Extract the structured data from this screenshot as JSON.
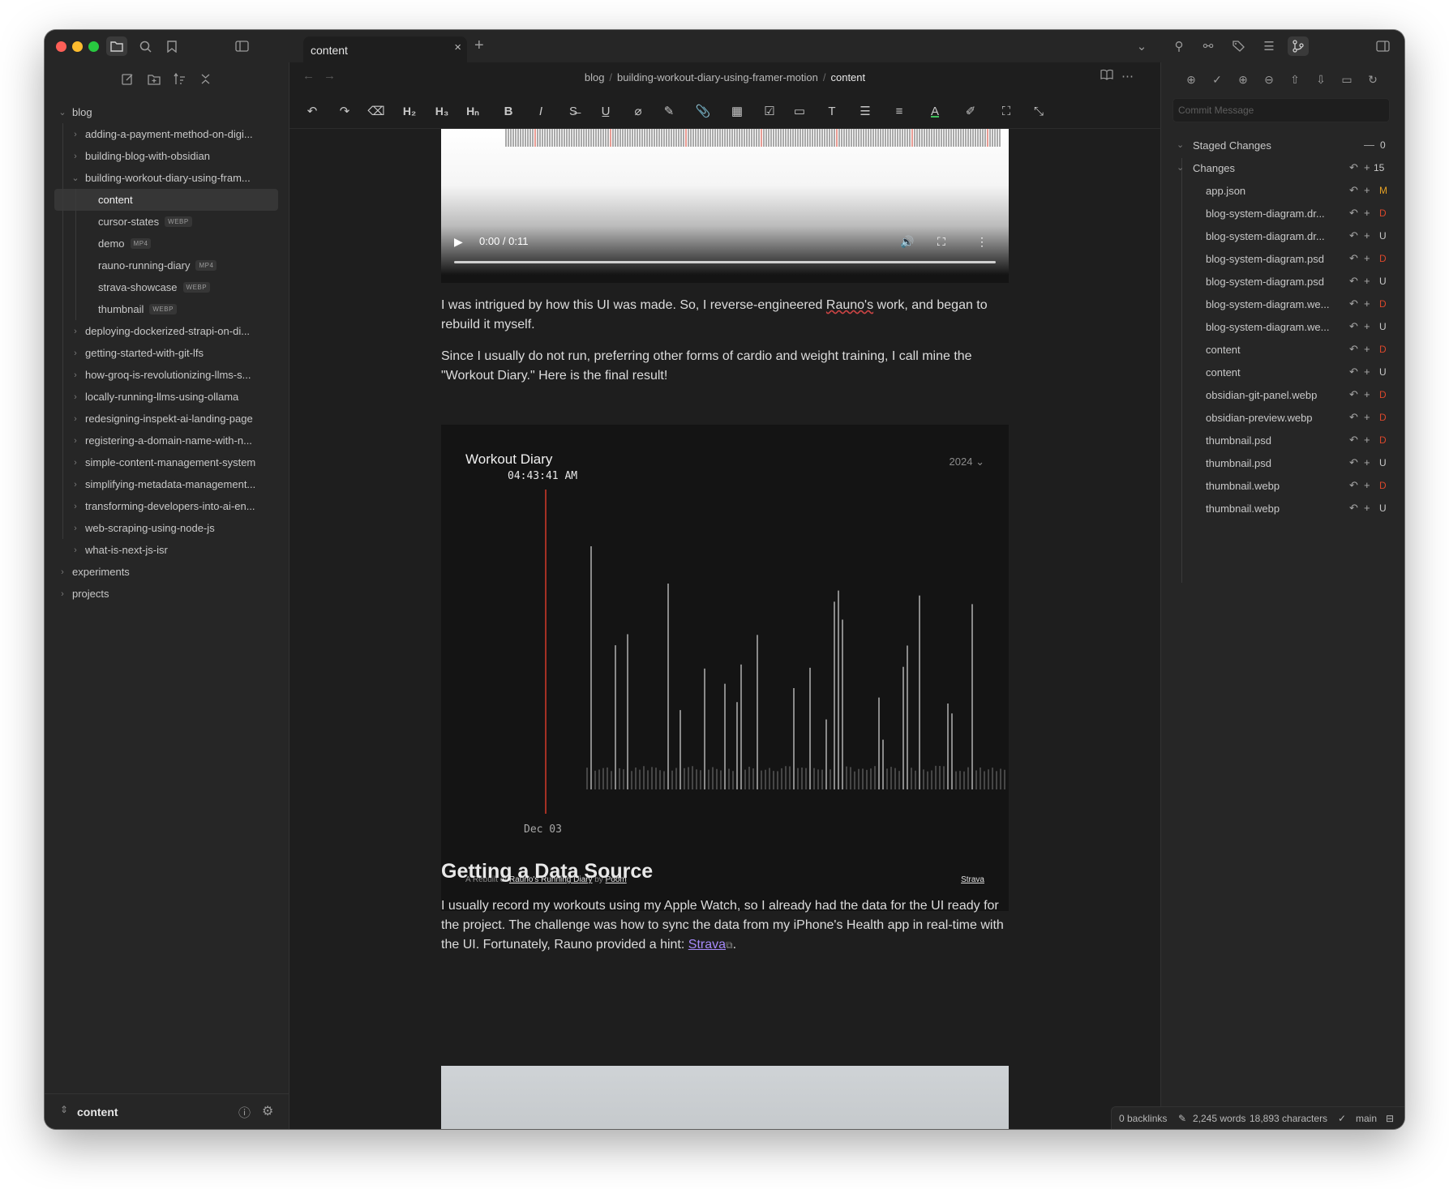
{
  "colors": {
    "window_bg": "#1e1e1e",
    "sidebar_bg": "#262626",
    "accent": "#a68af9",
    "deleted": "#d9472b",
    "modified": "#e5a125",
    "diary_line": "#ffffff",
    "diary_current": "#d43a2a"
  },
  "titlebar": {
    "tab_label": "content",
    "icons": [
      "folder-icon",
      "search-icon",
      "bookmark-icon",
      "sidebar-toggle-icon"
    ]
  },
  "left_sidebar": {
    "actions": [
      "new-note-icon",
      "new-folder-icon",
      "sort-icon",
      "collapse-icon"
    ],
    "tree": [
      {
        "label": "blog",
        "depth": 0,
        "open": true
      },
      {
        "label": "adding-a-payment-method-on-digi...",
        "depth": 1,
        "open": false
      },
      {
        "label": "building-blog-with-obsidian",
        "depth": 1,
        "open": false
      },
      {
        "label": "building-workout-diary-using-fram...",
        "depth": 1,
        "open": true
      },
      {
        "label": "content",
        "depth": 2,
        "active": true
      },
      {
        "label": "cursor-states",
        "depth": 2,
        "tag": "WEBP"
      },
      {
        "label": "demo",
        "depth": 2,
        "tag": "MP4"
      },
      {
        "label": "rauno-running-diary",
        "depth": 2,
        "tag": "MP4"
      },
      {
        "label": "strava-showcase",
        "depth": 2,
        "tag": "WEBP"
      },
      {
        "label": "thumbnail",
        "depth": 2,
        "tag": "WEBP"
      },
      {
        "label": "deploying-dockerized-strapi-on-di...",
        "depth": 1,
        "open": false
      },
      {
        "label": "getting-started-with-git-lfs",
        "depth": 1,
        "open": false
      },
      {
        "label": "how-groq-is-revolutionizing-llms-s...",
        "depth": 1,
        "open": false
      },
      {
        "label": "locally-running-llms-using-ollama",
        "depth": 1,
        "open": false
      },
      {
        "label": "redesigning-inspekt-ai-landing-page",
        "depth": 1,
        "open": false
      },
      {
        "label": "registering-a-domain-name-with-n...",
        "depth": 1,
        "open": false
      },
      {
        "label": "simple-content-management-system",
        "depth": 1,
        "open": false
      },
      {
        "label": "simplifying-metadata-management...",
        "depth": 1,
        "open": false
      },
      {
        "label": "transforming-developers-into-ai-en...",
        "depth": 1,
        "open": false
      },
      {
        "label": "web-scraping-using-node-js",
        "depth": 1,
        "open": false
      },
      {
        "label": "what-is-next-js-isr",
        "depth": 1,
        "open": false
      },
      {
        "label": "experiments",
        "depth": 0,
        "open": false
      },
      {
        "label": "projects",
        "depth": 0,
        "open": false
      }
    ],
    "footer": {
      "vault_name": "content"
    }
  },
  "main": {
    "breadcrumb": [
      "blog",
      "building-workout-diary-using-framer-motion",
      "content"
    ],
    "toolbar": [
      {
        "name": "undo-icon",
        "glyph": "↶"
      },
      {
        "name": "redo-icon",
        "glyph": "↷"
      },
      {
        "name": "eraser-icon",
        "glyph": "⌫"
      },
      {
        "name": "heading-2-button",
        "glyph": "H₂"
      },
      {
        "name": "heading-3-button",
        "glyph": "H₃"
      },
      {
        "name": "heading-n-button",
        "glyph": "Hₙ"
      },
      {
        "name": "bold-icon",
        "glyph": "B"
      },
      {
        "name": "italic-icon",
        "glyph": "I"
      },
      {
        "name": "strikethrough-icon",
        "glyph": "S̶"
      },
      {
        "name": "underline-icon",
        "glyph": "U̲"
      },
      {
        "name": "clear-format-icon",
        "glyph": "⌀"
      },
      {
        "name": "edit-icon",
        "glyph": "✎"
      },
      {
        "name": "attachment-icon",
        "glyph": "📎"
      },
      {
        "name": "table-icon",
        "glyph": "▦"
      },
      {
        "name": "checklist-icon",
        "glyph": "☑"
      },
      {
        "name": "comment-icon",
        "glyph": "▭"
      },
      {
        "name": "text-size-icon",
        "glyph": "T"
      },
      {
        "name": "list-icon",
        "glyph": "☰"
      },
      {
        "name": "align-icon",
        "glyph": "≡"
      },
      {
        "name": "text-color-icon",
        "glyph": "A"
      },
      {
        "name": "highlight-icon",
        "glyph": "✐"
      },
      {
        "name": "fullscreen-icon",
        "glyph": "⛶"
      },
      {
        "name": "exit-fullscreen-icon",
        "glyph": "⤡"
      }
    ],
    "video": {
      "time": "0:00 / 0:11"
    },
    "paragraph_1": {
      "before": "I was intrigued by how this UI was made. So, I reverse-engineered ",
      "spell": "Rauno's",
      "after": " work, and began to rebuild it myself."
    },
    "paragraph_2": "Since I usually do not run, preferring other forms of cardio and weight training, I call mine the \"Workout Diary.\" Here is the final result!",
    "workout_diary": {
      "title": "Workout Diary",
      "time": "04:43:41 AM",
      "year": "2024",
      "date_label": "Dec 03",
      "credit_prefix": "A Rebuilt of",
      "credit_link": "Rauno's Running Diary",
      "credit_by": "by",
      "credit_author": "Poom",
      "strava_link": "Strava"
    },
    "heading": "Getting a Data Source",
    "paragraph_3": {
      "text": "I usually record my workouts using my Apple Watch, so I already had the data for the UI ready for the project. The challenge was how to sync the data from my iPhone's Health app in real-time with the UI. Fortunately, Rauno provided a hint: ",
      "link": "Strava",
      "end": "."
    }
  },
  "right_sidebar": {
    "actions": [
      "push-icon",
      "commit-icon",
      "stage-all-icon",
      "unstage-all-icon",
      "upload-icon",
      "download-icon",
      "open-folder-icon",
      "refresh-icon"
    ],
    "commit_placeholder": "Commit Message",
    "staged": {
      "label": "Staged Changes",
      "count": "0"
    },
    "changes": {
      "label": "Changes",
      "count": "15"
    },
    "files": [
      {
        "name": "app.json",
        "status": "M"
      },
      {
        "name": "blog-system-diagram.dr...",
        "status": "D"
      },
      {
        "name": "blog-system-diagram.dr...",
        "status": "U"
      },
      {
        "name": "blog-system-diagram.psd",
        "status": "D"
      },
      {
        "name": "blog-system-diagram.psd",
        "status": "U"
      },
      {
        "name": "blog-system-diagram.we...",
        "status": "D"
      },
      {
        "name": "blog-system-diagram.we...",
        "status": "U"
      },
      {
        "name": "content",
        "status": "D"
      },
      {
        "name": "content",
        "status": "U"
      },
      {
        "name": "obsidian-git-panel.webp",
        "status": "D"
      },
      {
        "name": "obsidian-preview.webp",
        "status": "D"
      },
      {
        "name": "thumbnail.psd",
        "status": "D"
      },
      {
        "name": "thumbnail.psd",
        "status": "U"
      },
      {
        "name": "thumbnail.webp",
        "status": "D"
      },
      {
        "name": "thumbnail.webp",
        "status": "U"
      }
    ]
  },
  "status_bar": {
    "backlinks": "0 backlinks",
    "words": "2,245 words",
    "characters": "18,893 characters",
    "branch": "main"
  }
}
